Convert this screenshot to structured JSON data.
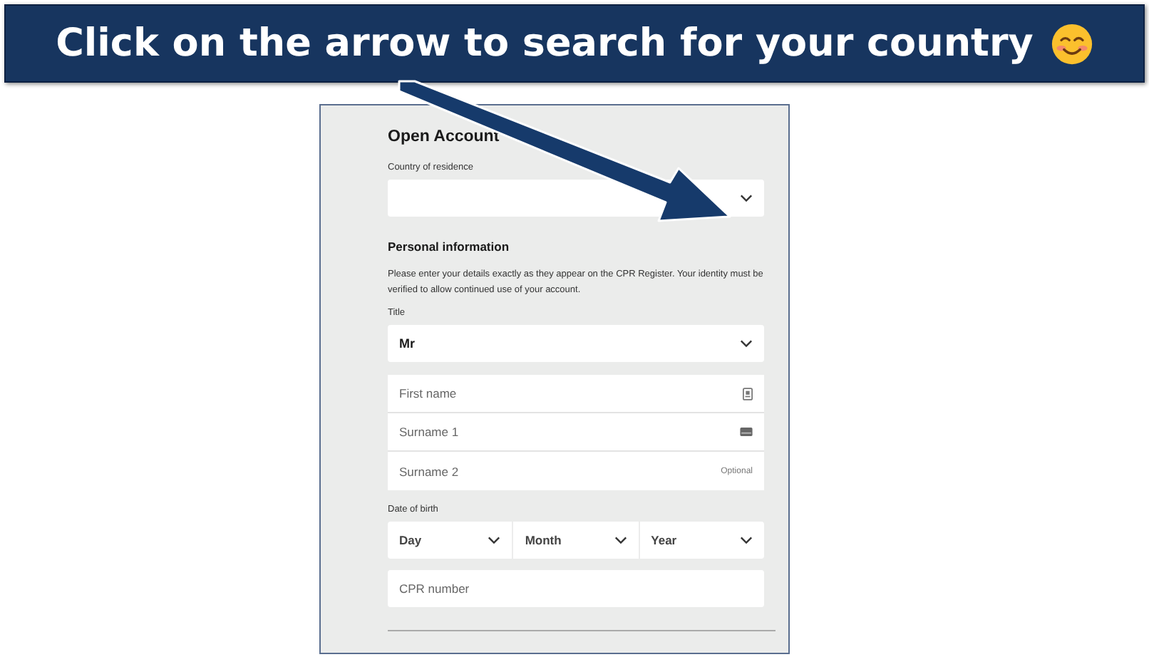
{
  "banner": {
    "text": "Click on the arrow to search for your country"
  },
  "form": {
    "heading": "Open Account",
    "country_label": "Country of residence",
    "section_heading": "Personal information",
    "description": "Please enter your details exactly as they appear on the CPR Register. Your identity must be verified to allow continued use of your account.",
    "title_label": "Title",
    "title_value": "Mr",
    "name_fields": [
      {
        "placeholder": "First name",
        "kind": "badge"
      },
      {
        "placeholder": "Surname 1",
        "kind": "card"
      },
      {
        "placeholder": "Surname 2",
        "kind": "note",
        "note": "Optional"
      }
    ],
    "dob_label": "Date of birth",
    "dob_selects": [
      "Day",
      "Month",
      "Year"
    ],
    "cpr_placeholder": "CPR number"
  }
}
